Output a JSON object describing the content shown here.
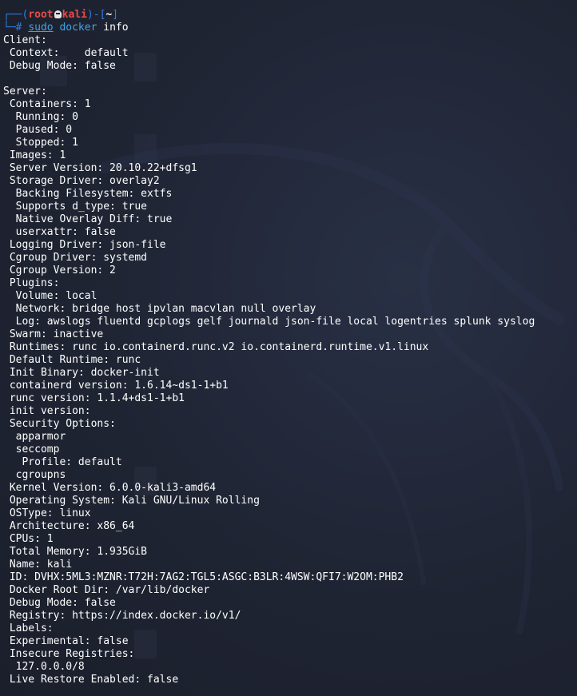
{
  "prompt": {
    "frame_open": "┌──(",
    "user": "root",
    "host": "kali",
    "frame_mid": ")-[",
    "dir": "~",
    "frame_close": "]",
    "second_line_prefix": "└─# ",
    "cmd_sudo": "sudo",
    "cmd_bin": "docker",
    "cmd_arg": " info"
  },
  "output_lines": [
    "Client:",
    " Context:    default",
    " Debug Mode: false",
    "",
    "Server:",
    " Containers: 1",
    "  Running: 0",
    "  Paused: 0",
    "  Stopped: 1",
    " Images: 1",
    " Server Version: 20.10.22+dfsg1",
    " Storage Driver: overlay2",
    "  Backing Filesystem: extfs",
    "  Supports d_type: true",
    "  Native Overlay Diff: true",
    "  userxattr: false",
    " Logging Driver: json-file",
    " Cgroup Driver: systemd",
    " Cgroup Version: 2",
    " Plugins:",
    "  Volume: local",
    "  Network: bridge host ipvlan macvlan null overlay",
    "  Log: awslogs fluentd gcplogs gelf journald json-file local logentries splunk syslog",
    " Swarm: inactive",
    " Runtimes: runc io.containerd.runc.v2 io.containerd.runtime.v1.linux",
    " Default Runtime: runc",
    " Init Binary: docker-init",
    " containerd version: 1.6.14~ds1-1+b1",
    " runc version: 1.1.4+ds1-1+b1",
    " init version:",
    " Security Options:",
    "  apparmor",
    "  seccomp",
    "   Profile: default",
    "  cgroupns",
    " Kernel Version: 6.0.0-kali3-amd64",
    " Operating System: Kali GNU/Linux Rolling",
    " OSType: linux",
    " Architecture: x86_64",
    " CPUs: 1",
    " Total Memory: 1.935GiB",
    " Name: kali",
    " ID: DVHX:5ML3:MZNR:T72H:7AG2:TGL5:ASGC:B3LR:4WSW:QFI7:W2OM:PHB2",
    " Docker Root Dir: /var/lib/docker",
    " Debug Mode: false",
    " Registry: https://index.docker.io/v1/",
    " Labels:",
    " Experimental: false",
    " Insecure Registries:",
    "  127.0.0.0/8",
    " Live Restore Enabled: false"
  ],
  "colors": {
    "background": "#1e2230",
    "text": "#ffffff",
    "prompt_frame": "#2f7de1",
    "prompt_user": "#e64b4b",
    "command": "#3ea4e8"
  },
  "icons": {
    "prompt_separator": "skull-icon"
  }
}
